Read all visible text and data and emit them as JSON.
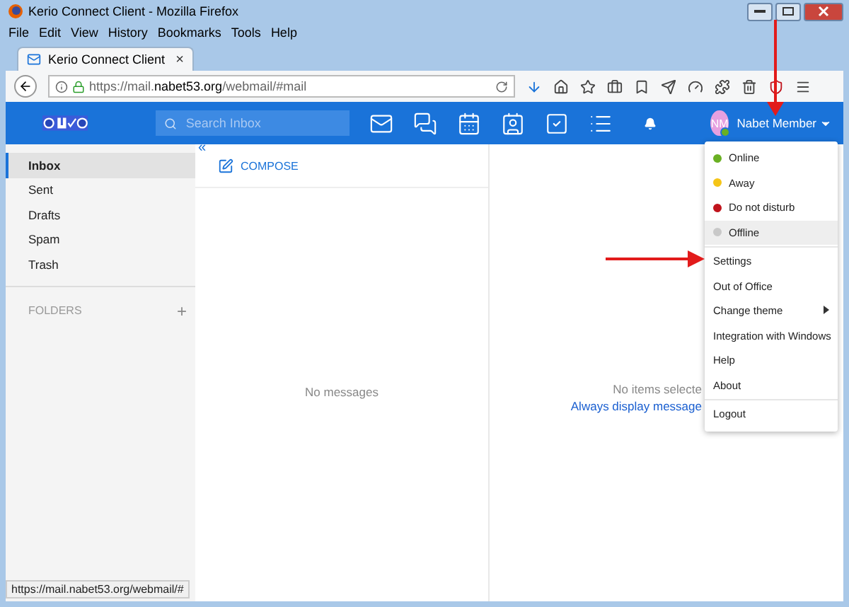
{
  "window": {
    "title": "Kerio Connect Client - Mozilla Firefox"
  },
  "menu_bar": [
    "File",
    "Edit",
    "View",
    "History",
    "Bookmarks",
    "Tools",
    "Help"
  ],
  "browser_tab": {
    "title": "Kerio Connect Client",
    "close": "×"
  },
  "address_bar": {
    "url": "https://mail.**nabet53.org**/webmail/#mail"
  },
  "app_header": {
    "search": {
      "placeholder": "Search Inbox"
    },
    "user": {
      "initials": "NM",
      "name": "Nabet Member",
      "color": "#6ab023"
    }
  },
  "sidebar": {
    "collapse": "«",
    "items": [
      {
        "label": "Inbox",
        "selected": true
      },
      {
        "label": "Sent",
        "selected": false
      },
      {
        "label": "Drafts",
        "selected": false
      },
      {
        "label": "Spam",
        "selected": false
      },
      {
        "label": "Trash",
        "selected": false
      }
    ],
    "folders_heading": "FOLDERS",
    "add": "+"
  },
  "message_list": {
    "compose": "COMPOSE",
    "empty": "No messages"
  },
  "preview": {
    "empty": "No items selecte",
    "link": "Always display message"
  },
  "user_menu": [
    {
      "kind": "status",
      "label": "Online",
      "color": "#6ab023",
      "highlighted": false
    },
    {
      "kind": "status",
      "label": "Away",
      "color": "#f5c518",
      "highlighted": false
    },
    {
      "kind": "status",
      "label": "Do not disturb",
      "color": "#c0141c",
      "highlighted": false
    },
    {
      "kind": "status",
      "label": "Offline",
      "color": "#c8c8c8",
      "highlighted": true
    },
    {
      "kind": "divider"
    },
    {
      "kind": "action",
      "label": "Settings",
      "highlighted": false
    },
    {
      "kind": "action",
      "label": "Out of Office",
      "highlighted": false
    },
    {
      "kind": "submenu",
      "label": "Change theme",
      "highlighted": false
    },
    {
      "kind": "action",
      "label": "Integration with Windows",
      "highlighted": false
    },
    {
      "kind": "action",
      "label": "Help",
      "highlighted": false
    },
    {
      "kind": "action",
      "label": "About",
      "highlighted": false
    },
    {
      "kind": "divider"
    },
    {
      "kind": "action",
      "label": "Logout",
      "highlighted": false
    }
  ],
  "status_link": "https://mail.nabet53.org/webmail/#"
}
